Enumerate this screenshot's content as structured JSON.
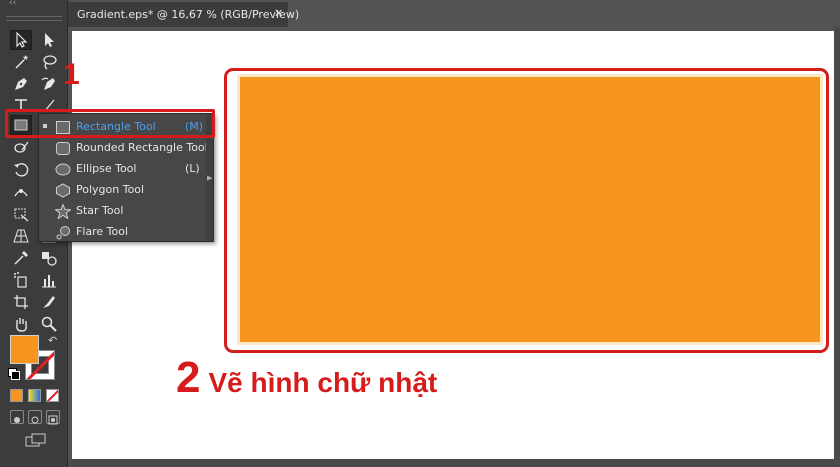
{
  "document_tab": {
    "title": "Gradient.eps* @ 16,67 % (RGB/Preview)",
    "close_glyph": "✕"
  },
  "toolbar": {
    "collapse_glyph": "‹‹",
    "fill_color": "#f7941d",
    "stroke": "none"
  },
  "flyout": {
    "items": [
      {
        "label": "Rectangle Tool",
        "shortcut": "(M)",
        "icon": "rectangle-icon",
        "selected": true
      },
      {
        "label": "Rounded Rectangle Tool",
        "shortcut": "",
        "icon": "rounded-rectangle-icon",
        "selected": false
      },
      {
        "label": "Ellipse Tool",
        "shortcut": "(L)",
        "icon": "ellipse-icon",
        "selected": false
      },
      {
        "label": "Polygon Tool",
        "shortcut": "",
        "icon": "polygon-icon",
        "selected": false
      },
      {
        "label": "Star Tool",
        "shortcut": "",
        "icon": "star-icon",
        "selected": false
      },
      {
        "label": "Flare Tool",
        "shortcut": "",
        "icon": "flare-icon",
        "selected": false
      }
    ]
  },
  "annotations": {
    "step1_number": "1",
    "step2_number": "2",
    "step2_text": "Vẽ hình chữ nhật"
  },
  "colors": {
    "shape_fill": "#f7941d",
    "highlight": "#d61b1b",
    "selected_text": "#4aa0f0"
  }
}
